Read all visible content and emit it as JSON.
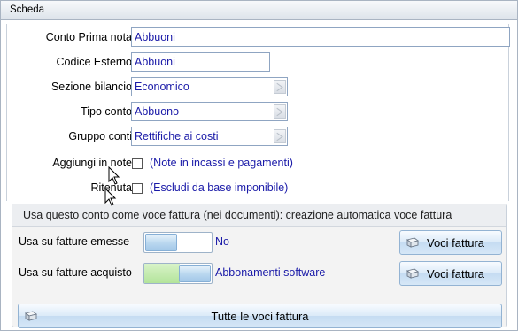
{
  "panel": {
    "title": "Scheda"
  },
  "form": {
    "conto_prima_nota": {
      "label": "Conto Prima nota",
      "value": "Abbuoni"
    },
    "codice_esterno": {
      "label": "Codice Esterno",
      "value": "Abbuoni"
    },
    "sezione_bilancio": {
      "label": "Sezione bilancio",
      "value": "Economico"
    },
    "tipo_conto": {
      "label": "Tipo conto",
      "value": "Abbuono"
    },
    "gruppo_conti": {
      "label": "Gruppo conti",
      "value": "Rettifiche ai costi"
    },
    "aggiungi_in_note": {
      "label": "Aggiungi in note",
      "checked": false,
      "text": "(Note in incassi e pagamenti)"
    },
    "ritenuta": {
      "label": "Ritenuta",
      "checked": false,
      "text": "(Escludi da base imponibile)"
    }
  },
  "invoice_section": {
    "title": "Usa questo conto come voce fattura  (nei documenti): creazione automatica voce fattura",
    "emesse": {
      "label": "Usa su fatture emesse",
      "toggle_on": false,
      "value": "No",
      "button": "Voci fattura"
    },
    "acquisto": {
      "label": "Usa su fatture acquisto",
      "toggle_on": true,
      "value": "Abbonamenti software",
      "button": "Voci fattura"
    },
    "all_button": "Tutte le voci fattura"
  },
  "icons": {
    "combo": "dropdown-arrow-icon",
    "button": "document-arrow-icon",
    "cursor": "mouse-pointer-icon"
  }
}
